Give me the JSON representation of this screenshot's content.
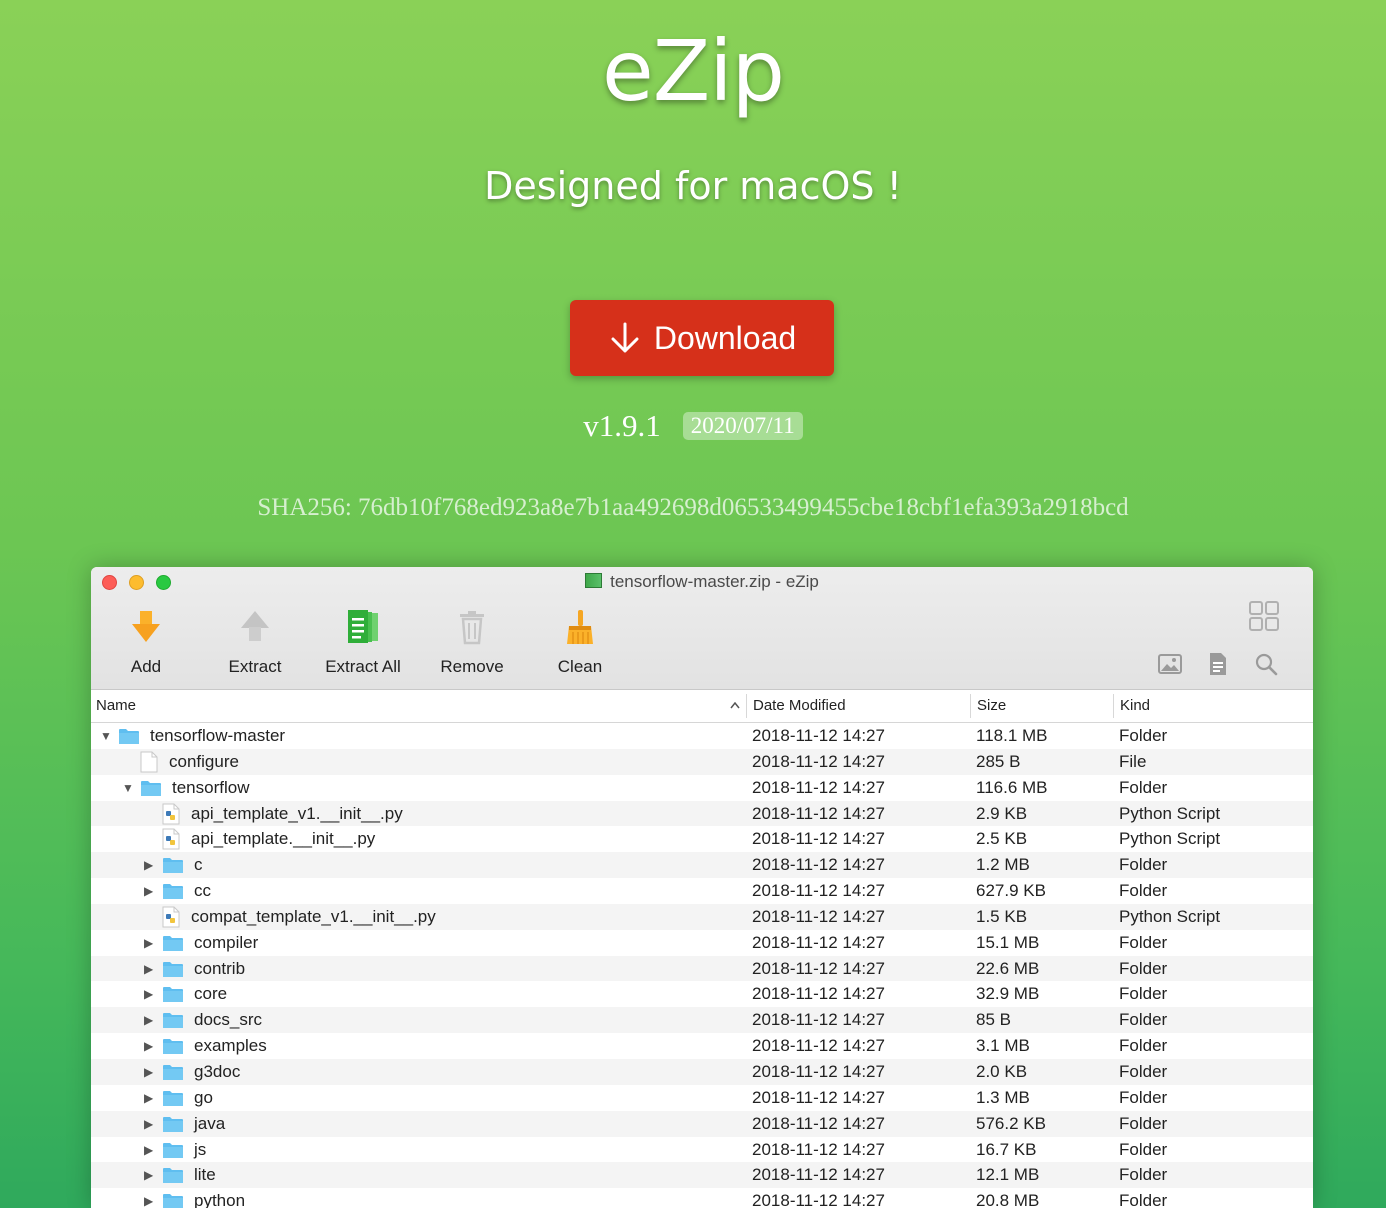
{
  "hero": {
    "title": "eZip",
    "subtitle": "Designed for macOS !",
    "download_label": "Download",
    "version": "v1.9.1",
    "release_date": "2020/07/11",
    "sha": "SHA256: 76db10f768ed923a8e7b1aa492698d06533499455cbe18cbf1efa393a2918bcd"
  },
  "window": {
    "title": "tensorflow-master.zip - eZip",
    "toolbar": {
      "add": "Add",
      "extract": "Extract",
      "extract_all": "Extract All",
      "remove": "Remove",
      "clean": "Clean"
    },
    "columns": {
      "name": "Name",
      "date": "Date Modified",
      "size": "Size",
      "kind": "Kind"
    },
    "rows": [
      {
        "name": "tensorflow-master",
        "date": "2018-11-12 14:27",
        "size": "118.1 MB",
        "kind": "Folder",
        "level": 0,
        "icon": "folder",
        "toggle": "expanded"
      },
      {
        "name": "configure",
        "date": "2018-11-12 14:27",
        "size": "285 B",
        "kind": "File",
        "level": 1,
        "icon": "file",
        "toggle": "none"
      },
      {
        "name": "tensorflow",
        "date": "2018-11-12 14:27",
        "size": "116.6 MB",
        "kind": "Folder",
        "level": 1,
        "icon": "folder",
        "toggle": "expanded"
      },
      {
        "name": "api_template_v1.__init__.py",
        "date": "2018-11-12 14:27",
        "size": "2.9 KB",
        "kind": "Python Script",
        "level": 2,
        "icon": "python",
        "toggle": "none"
      },
      {
        "name": "api_template.__init__.py",
        "date": "2018-11-12 14:27",
        "size": "2.5 KB",
        "kind": "Python Script",
        "level": 2,
        "icon": "python",
        "toggle": "none"
      },
      {
        "name": "c",
        "date": "2018-11-12 14:27",
        "size": "1.2 MB",
        "kind": "Folder",
        "level": 2,
        "icon": "folder",
        "toggle": "collapsed"
      },
      {
        "name": "cc",
        "date": "2018-11-12 14:27",
        "size": "627.9 KB",
        "kind": "Folder",
        "level": 2,
        "icon": "folder",
        "toggle": "collapsed"
      },
      {
        "name": "compat_template_v1.__init__.py",
        "date": "2018-11-12 14:27",
        "size": "1.5 KB",
        "kind": "Python Script",
        "level": 2,
        "icon": "python",
        "toggle": "none"
      },
      {
        "name": "compiler",
        "date": "2018-11-12 14:27",
        "size": "15.1 MB",
        "kind": "Folder",
        "level": 2,
        "icon": "folder",
        "toggle": "collapsed"
      },
      {
        "name": "contrib",
        "date": "2018-11-12 14:27",
        "size": "22.6 MB",
        "kind": "Folder",
        "level": 2,
        "icon": "folder",
        "toggle": "collapsed"
      },
      {
        "name": "core",
        "date": "2018-11-12 14:27",
        "size": "32.9 MB",
        "kind": "Folder",
        "level": 2,
        "icon": "folder",
        "toggle": "collapsed"
      },
      {
        "name": "docs_src",
        "date": "2018-11-12 14:27",
        "size": "85 B",
        "kind": "Folder",
        "level": 2,
        "icon": "folder",
        "toggle": "collapsed"
      },
      {
        "name": "examples",
        "date": "2018-11-12 14:27",
        "size": "3.1 MB",
        "kind": "Folder",
        "level": 2,
        "icon": "folder",
        "toggle": "collapsed"
      },
      {
        "name": "g3doc",
        "date": "2018-11-12 14:27",
        "size": "2.0 KB",
        "kind": "Folder",
        "level": 2,
        "icon": "folder",
        "toggle": "collapsed"
      },
      {
        "name": "go",
        "date": "2018-11-12 14:27",
        "size": "1.3 MB",
        "kind": "Folder",
        "level": 2,
        "icon": "folder",
        "toggle": "collapsed"
      },
      {
        "name": "java",
        "date": "2018-11-12 14:27",
        "size": "576.2 KB",
        "kind": "Folder",
        "level": 2,
        "icon": "folder",
        "toggle": "collapsed"
      },
      {
        "name": "js",
        "date": "2018-11-12 14:27",
        "size": "16.7 KB",
        "kind": "Folder",
        "level": 2,
        "icon": "folder",
        "toggle": "collapsed"
      },
      {
        "name": "lite",
        "date": "2018-11-12 14:27",
        "size": "12.1 MB",
        "kind": "Folder",
        "level": 2,
        "icon": "folder",
        "toggle": "collapsed"
      },
      {
        "name": "python",
        "date": "2018-11-12 14:27",
        "size": "20.8 MB",
        "kind": "Folder",
        "level": 2,
        "icon": "folder",
        "toggle": "collapsed"
      }
    ]
  },
  "colors": {
    "download_button": "#d6301a",
    "folder_icon": "#5fbef0",
    "hero_green": "#6cc653"
  }
}
